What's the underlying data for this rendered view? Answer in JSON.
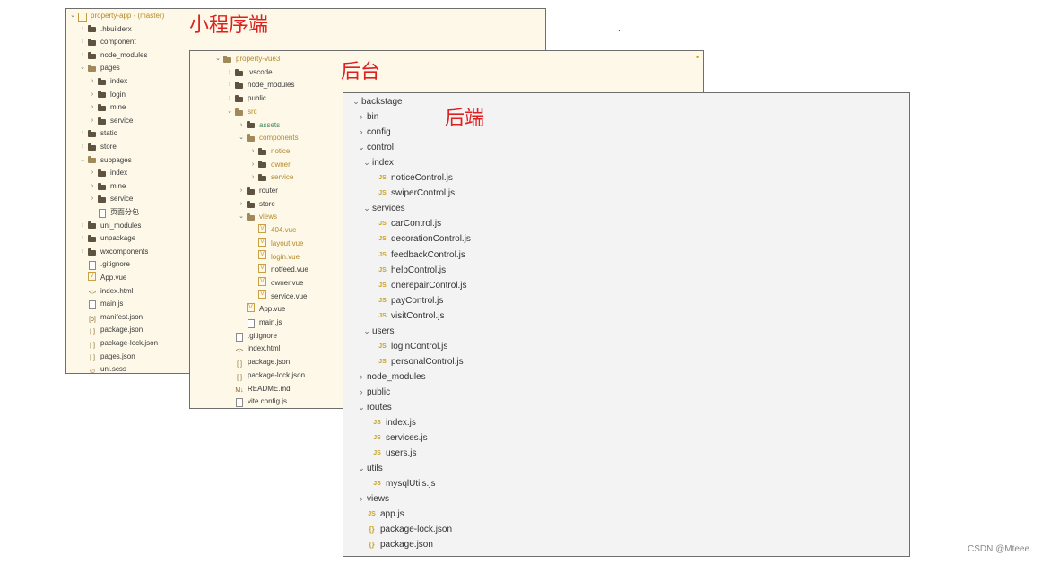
{
  "titles": {
    "mini_program": "小程序端",
    "admin": "后台",
    "backend": "后端"
  },
  "credit": "CSDN @Mteee.",
  "stray_dot": ".",
  "mini_program_tree": [
    {
      "depth": 0,
      "chev": "⌄",
      "icon": "project",
      "label": "property-app - (master)",
      "style": "gold"
    },
    {
      "depth": 1,
      "chev": "›",
      "icon": "folder",
      "label": ".hbuilderx"
    },
    {
      "depth": 1,
      "chev": "›",
      "icon": "folder",
      "label": "component"
    },
    {
      "depth": 1,
      "chev": "›",
      "icon": "folder",
      "label": "node_modules"
    },
    {
      "depth": 1,
      "chev": "⌄",
      "icon": "folder-open",
      "label": "pages"
    },
    {
      "depth": 2,
      "chev": "›",
      "icon": "folder",
      "label": "index"
    },
    {
      "depth": 2,
      "chev": "›",
      "icon": "folder",
      "label": "login"
    },
    {
      "depth": 2,
      "chev": "›",
      "icon": "folder",
      "label": "mine"
    },
    {
      "depth": 2,
      "chev": "›",
      "icon": "folder",
      "label": "service"
    },
    {
      "depth": 1,
      "chev": "›",
      "icon": "folder",
      "label": "static"
    },
    {
      "depth": 1,
      "chev": "›",
      "icon": "folder",
      "label": "store"
    },
    {
      "depth": 1,
      "chev": "⌄",
      "icon": "folder-open",
      "label": "subpages"
    },
    {
      "depth": 2,
      "chev": "›",
      "icon": "folder",
      "label": "index"
    },
    {
      "depth": 2,
      "chev": "›",
      "icon": "folder",
      "label": "mine"
    },
    {
      "depth": 2,
      "chev": "›",
      "icon": "folder",
      "label": "service"
    },
    {
      "depth": 2,
      "chev": "",
      "icon": "file",
      "label": "页面分包"
    },
    {
      "depth": 1,
      "chev": "›",
      "icon": "folder",
      "label": "uni_modules"
    },
    {
      "depth": 1,
      "chev": "›",
      "icon": "folder",
      "label": "unpackage"
    },
    {
      "depth": 1,
      "chev": "›",
      "icon": "folder",
      "label": "wxcomponents"
    },
    {
      "depth": 1,
      "chev": "",
      "icon": "file",
      "label": ".gitignore"
    },
    {
      "depth": 1,
      "chev": "",
      "icon": "vue",
      "label": "App.vue"
    },
    {
      "depth": 1,
      "chev": "",
      "icon": "glyph",
      "glyph": "<>",
      "label": "index.html"
    },
    {
      "depth": 1,
      "chev": "",
      "icon": "file",
      "label": "main.js"
    },
    {
      "depth": 1,
      "chev": "",
      "icon": "glyph",
      "glyph": "[o]",
      "label": "manifest.json"
    },
    {
      "depth": 1,
      "chev": "",
      "icon": "glyph",
      "glyph": "[ ]",
      "label": "package.json"
    },
    {
      "depth": 1,
      "chev": "",
      "icon": "glyph",
      "glyph": "[ ]",
      "label": "package-lock.json"
    },
    {
      "depth": 1,
      "chev": "",
      "icon": "glyph",
      "glyph": "[ ]",
      "label": "pages.json"
    },
    {
      "depth": 1,
      "chev": "",
      "icon": "glyph",
      "glyph": "∅",
      "label": "uni.scss"
    }
  ],
  "admin_tree": [
    {
      "depth": 0,
      "chev": "⌄",
      "icon": "folder-open",
      "label": "property-vue3",
      "style": "gold"
    },
    {
      "depth": 1,
      "chev": "›",
      "icon": "folder",
      "label": ".vscode"
    },
    {
      "depth": 1,
      "chev": "›",
      "icon": "folder",
      "label": "node_modules"
    },
    {
      "depth": 1,
      "chev": "›",
      "icon": "folder",
      "label": "public"
    },
    {
      "depth": 1,
      "chev": "⌄",
      "icon": "folder-open",
      "label": "src",
      "style": "gold"
    },
    {
      "depth": 2,
      "chev": "›",
      "icon": "folder",
      "label": "assets",
      "style": "green"
    },
    {
      "depth": 2,
      "chev": "⌄",
      "icon": "folder-open",
      "label": "components",
      "style": "gold"
    },
    {
      "depth": 3,
      "chev": "›",
      "icon": "folder",
      "label": "notice",
      "style": "gold"
    },
    {
      "depth": 3,
      "chev": "›",
      "icon": "folder",
      "label": "owner",
      "style": "gold"
    },
    {
      "depth": 3,
      "chev": "›",
      "icon": "folder",
      "label": "service",
      "style": "gold"
    },
    {
      "depth": 2,
      "chev": "›",
      "icon": "folder",
      "label": "router"
    },
    {
      "depth": 2,
      "chev": "›",
      "icon": "folder",
      "label": "store"
    },
    {
      "depth": 2,
      "chev": "⌄",
      "icon": "folder-open",
      "label": "views",
      "style": "gold"
    },
    {
      "depth": 3,
      "chev": "",
      "icon": "vue",
      "label": "404.vue",
      "style": "gold"
    },
    {
      "depth": 3,
      "chev": "",
      "icon": "vue",
      "label": "layout.vue",
      "style": "gold"
    },
    {
      "depth": 3,
      "chev": "",
      "icon": "vue",
      "label": "login.vue",
      "style": "gold"
    },
    {
      "depth": 3,
      "chev": "",
      "icon": "vue",
      "label": "notfeed.vue"
    },
    {
      "depth": 3,
      "chev": "",
      "icon": "vue",
      "label": "owner.vue"
    },
    {
      "depth": 3,
      "chev": "",
      "icon": "vue",
      "label": "service.vue"
    },
    {
      "depth": 2,
      "chev": "",
      "icon": "vue",
      "label": "App.vue"
    },
    {
      "depth": 2,
      "chev": "",
      "icon": "file",
      "label": "main.js"
    },
    {
      "depth": 1,
      "chev": "",
      "icon": "file",
      "label": ".gitignore"
    },
    {
      "depth": 1,
      "chev": "",
      "icon": "glyph",
      "glyph": "<>",
      "label": "index.html"
    },
    {
      "depth": 1,
      "chev": "",
      "icon": "glyph",
      "glyph": "[ ]",
      "label": "package.json"
    },
    {
      "depth": 1,
      "chev": "",
      "icon": "glyph",
      "glyph": "[ ]",
      "label": "package-lock.json"
    },
    {
      "depth": 1,
      "chev": "",
      "icon": "glyph",
      "glyph": "M↓",
      "label": "README.md"
    },
    {
      "depth": 1,
      "chev": "",
      "icon": "file",
      "label": "vite.config.js"
    }
  ],
  "admin_modified_marker": "•",
  "backend_tree": [
    {
      "depth": 0,
      "chev": "⌄",
      "icon": "none",
      "label": "backstage"
    },
    {
      "depth": 1,
      "chev": "›",
      "icon": "none",
      "label": "bin"
    },
    {
      "depth": 1,
      "chev": "›",
      "icon": "none",
      "label": "config"
    },
    {
      "depth": 1,
      "chev": "⌄",
      "icon": "none",
      "label": "control"
    },
    {
      "depth": 2,
      "chev": "⌄",
      "icon": "none",
      "label": "index"
    },
    {
      "depth": 3,
      "chev": "",
      "icon": "js",
      "label": "noticeControl.js"
    },
    {
      "depth": 3,
      "chev": "",
      "icon": "js",
      "label": "swiperControl.js"
    },
    {
      "depth": 2,
      "chev": "⌄",
      "icon": "none",
      "label": "services"
    },
    {
      "depth": 3,
      "chev": "",
      "icon": "js",
      "label": "carControl.js"
    },
    {
      "depth": 3,
      "chev": "",
      "icon": "js",
      "label": "decorationControl.js"
    },
    {
      "depth": 3,
      "chev": "",
      "icon": "js",
      "label": "feedbackControl.js"
    },
    {
      "depth": 3,
      "chev": "",
      "icon": "js",
      "label": "helpControl.js"
    },
    {
      "depth": 3,
      "chev": "",
      "icon": "js",
      "label": "onerepairControl.js"
    },
    {
      "depth": 3,
      "chev": "",
      "icon": "js",
      "label": "payControl.js"
    },
    {
      "depth": 3,
      "chev": "",
      "icon": "js",
      "label": "visitControl.js"
    },
    {
      "depth": 2,
      "chev": "⌄",
      "icon": "none",
      "label": "users"
    },
    {
      "depth": 3,
      "chev": "",
      "icon": "js",
      "label": "loginControl.js"
    },
    {
      "depth": 3,
      "chev": "",
      "icon": "js",
      "label": "personalControl.js"
    },
    {
      "depth": 1,
      "chev": "›",
      "icon": "none",
      "label": "node_modules"
    },
    {
      "depth": 1,
      "chev": "›",
      "icon": "none",
      "label": "public"
    },
    {
      "depth": 1,
      "chev": "⌄",
      "icon": "none",
      "label": "routes"
    },
    {
      "depth": 2,
      "chev": "",
      "icon": "js",
      "label": "index.js"
    },
    {
      "depth": 2,
      "chev": "",
      "icon": "js",
      "label": "services.js"
    },
    {
      "depth": 2,
      "chev": "",
      "icon": "js",
      "label": "users.js"
    },
    {
      "depth": 1,
      "chev": "⌄",
      "icon": "none",
      "label": "utils"
    },
    {
      "depth": 2,
      "chev": "",
      "icon": "js",
      "label": "mysqlUtils.js"
    },
    {
      "depth": 1,
      "chev": "›",
      "icon": "none",
      "label": "views"
    },
    {
      "depth": 1,
      "chev": "",
      "icon": "js",
      "label": "app.js"
    },
    {
      "depth": 1,
      "chev": "",
      "icon": "json",
      "label": "package-lock.json"
    },
    {
      "depth": 1,
      "chev": "",
      "icon": "json",
      "label": "package.json"
    }
  ],
  "icon_text": {
    "js": "JS",
    "json": "{}"
  }
}
